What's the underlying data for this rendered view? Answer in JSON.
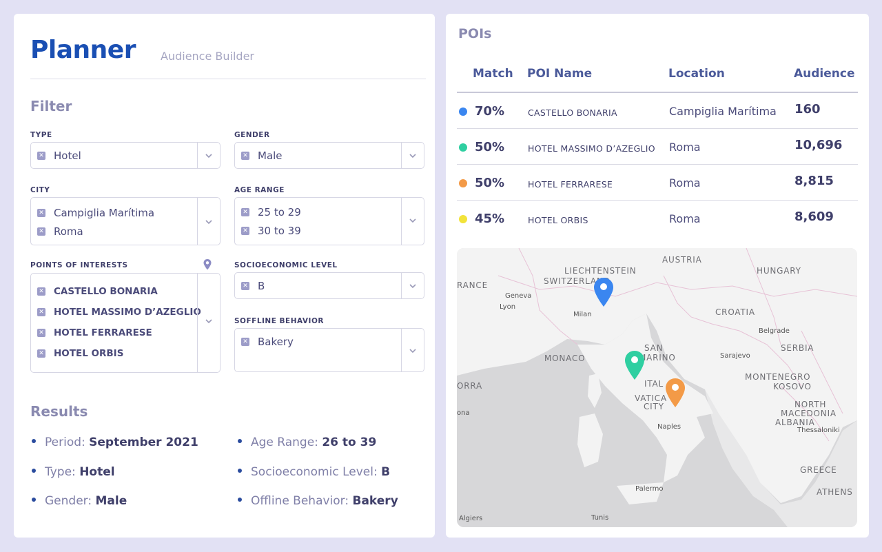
{
  "app": {
    "brand": "Planner",
    "subtitle": "Audience Builder"
  },
  "filter": {
    "title": "Filter",
    "type": {
      "label": "TYPE",
      "values": [
        "Hotel"
      ]
    },
    "gender": {
      "label": "GENDER",
      "values": [
        "Male"
      ]
    },
    "city": {
      "label": "CITY",
      "values": [
        "Campiglia Marítima",
        "Roma"
      ]
    },
    "age_range": {
      "label": "AGE RANGE",
      "values": [
        "25 to 29",
        "30 to 39"
      ]
    },
    "poi": {
      "label": "POINTS OF INTERESTS",
      "values": [
        "CASTELLO BONARIA",
        "HOTEL MASSIMO D’AZEGLIO",
        "HOTEL FERRARESE",
        "HOTEL ORBIS"
      ]
    },
    "socioeconomic": {
      "label": "SOCIOECONOMIC LEVEL",
      "values": [
        "B"
      ]
    },
    "offline": {
      "label": "SOFFLINE BEHAVIOR",
      "values": [
        "Bakery"
      ]
    }
  },
  "results": {
    "title": "Results",
    "items": [
      {
        "label": "Period:",
        "value": "September 2021"
      },
      {
        "label": "Age Range:",
        "value": "26 to 39"
      },
      {
        "label": "Type:",
        "value": "Hotel"
      },
      {
        "label": "Socioeconomic Level:",
        "value": "B"
      },
      {
        "label": "Gender:",
        "value": "Male"
      },
      {
        "label": "Offline Behavior:",
        "value": "Bakery"
      }
    ]
  },
  "pois": {
    "title": "POIs",
    "columns": [
      "Match",
      "POI Name",
      "Location",
      "Audience"
    ],
    "rows": [
      {
        "match": "70%",
        "name": "CASTELLO BONARIA",
        "location": "Campiglia Marítima",
        "audience": "160",
        "color": "#3a86f0"
      },
      {
        "match": "50%",
        "name": "HOTEL MASSIMO D’AZEGLIO",
        "location": "Roma",
        "audience": "10,696",
        "color": "#2fcfa1"
      },
      {
        "match": "50%",
        "name": "HOTEL FERRARESE",
        "location": "Roma",
        "audience": "8,815",
        "color": "#f39a47"
      },
      {
        "match": "45%",
        "name": "HOTEL ORBIS",
        "location": "Roma",
        "audience": "8,609",
        "color": "#f2e33a"
      }
    ]
  },
  "map": {
    "labels": [
      "LIECHTENSTEIN",
      "AUSTRIA",
      "HUNGARY",
      "SWITZERLAND",
      "RANCE",
      "CROATIA",
      "SERBIA",
      "MONACO",
      "SAN",
      "MARINO",
      "MONTENEGRO",
      "KOSOVO",
      "NORTH",
      "MACEDONIA",
      "ALBANIA",
      "GREECE",
      "ORRA",
      "ITAL",
      "VATICA",
      "CITY",
      "ATHENS"
    ],
    "cities": [
      "Geneva",
      "Lyon",
      "Milan",
      "Belgrade",
      "Sarajevo",
      "Naples",
      "Thessaloniki",
      "Palermo",
      "Tunis",
      "Algiers",
      "ona"
    ],
    "pins": [
      {
        "name": "blue-pin",
        "color": "#3a86f0"
      },
      {
        "name": "green-pin",
        "color": "#2fcfa1"
      },
      {
        "name": "orange-pin",
        "color": "#f39a47"
      }
    ]
  }
}
